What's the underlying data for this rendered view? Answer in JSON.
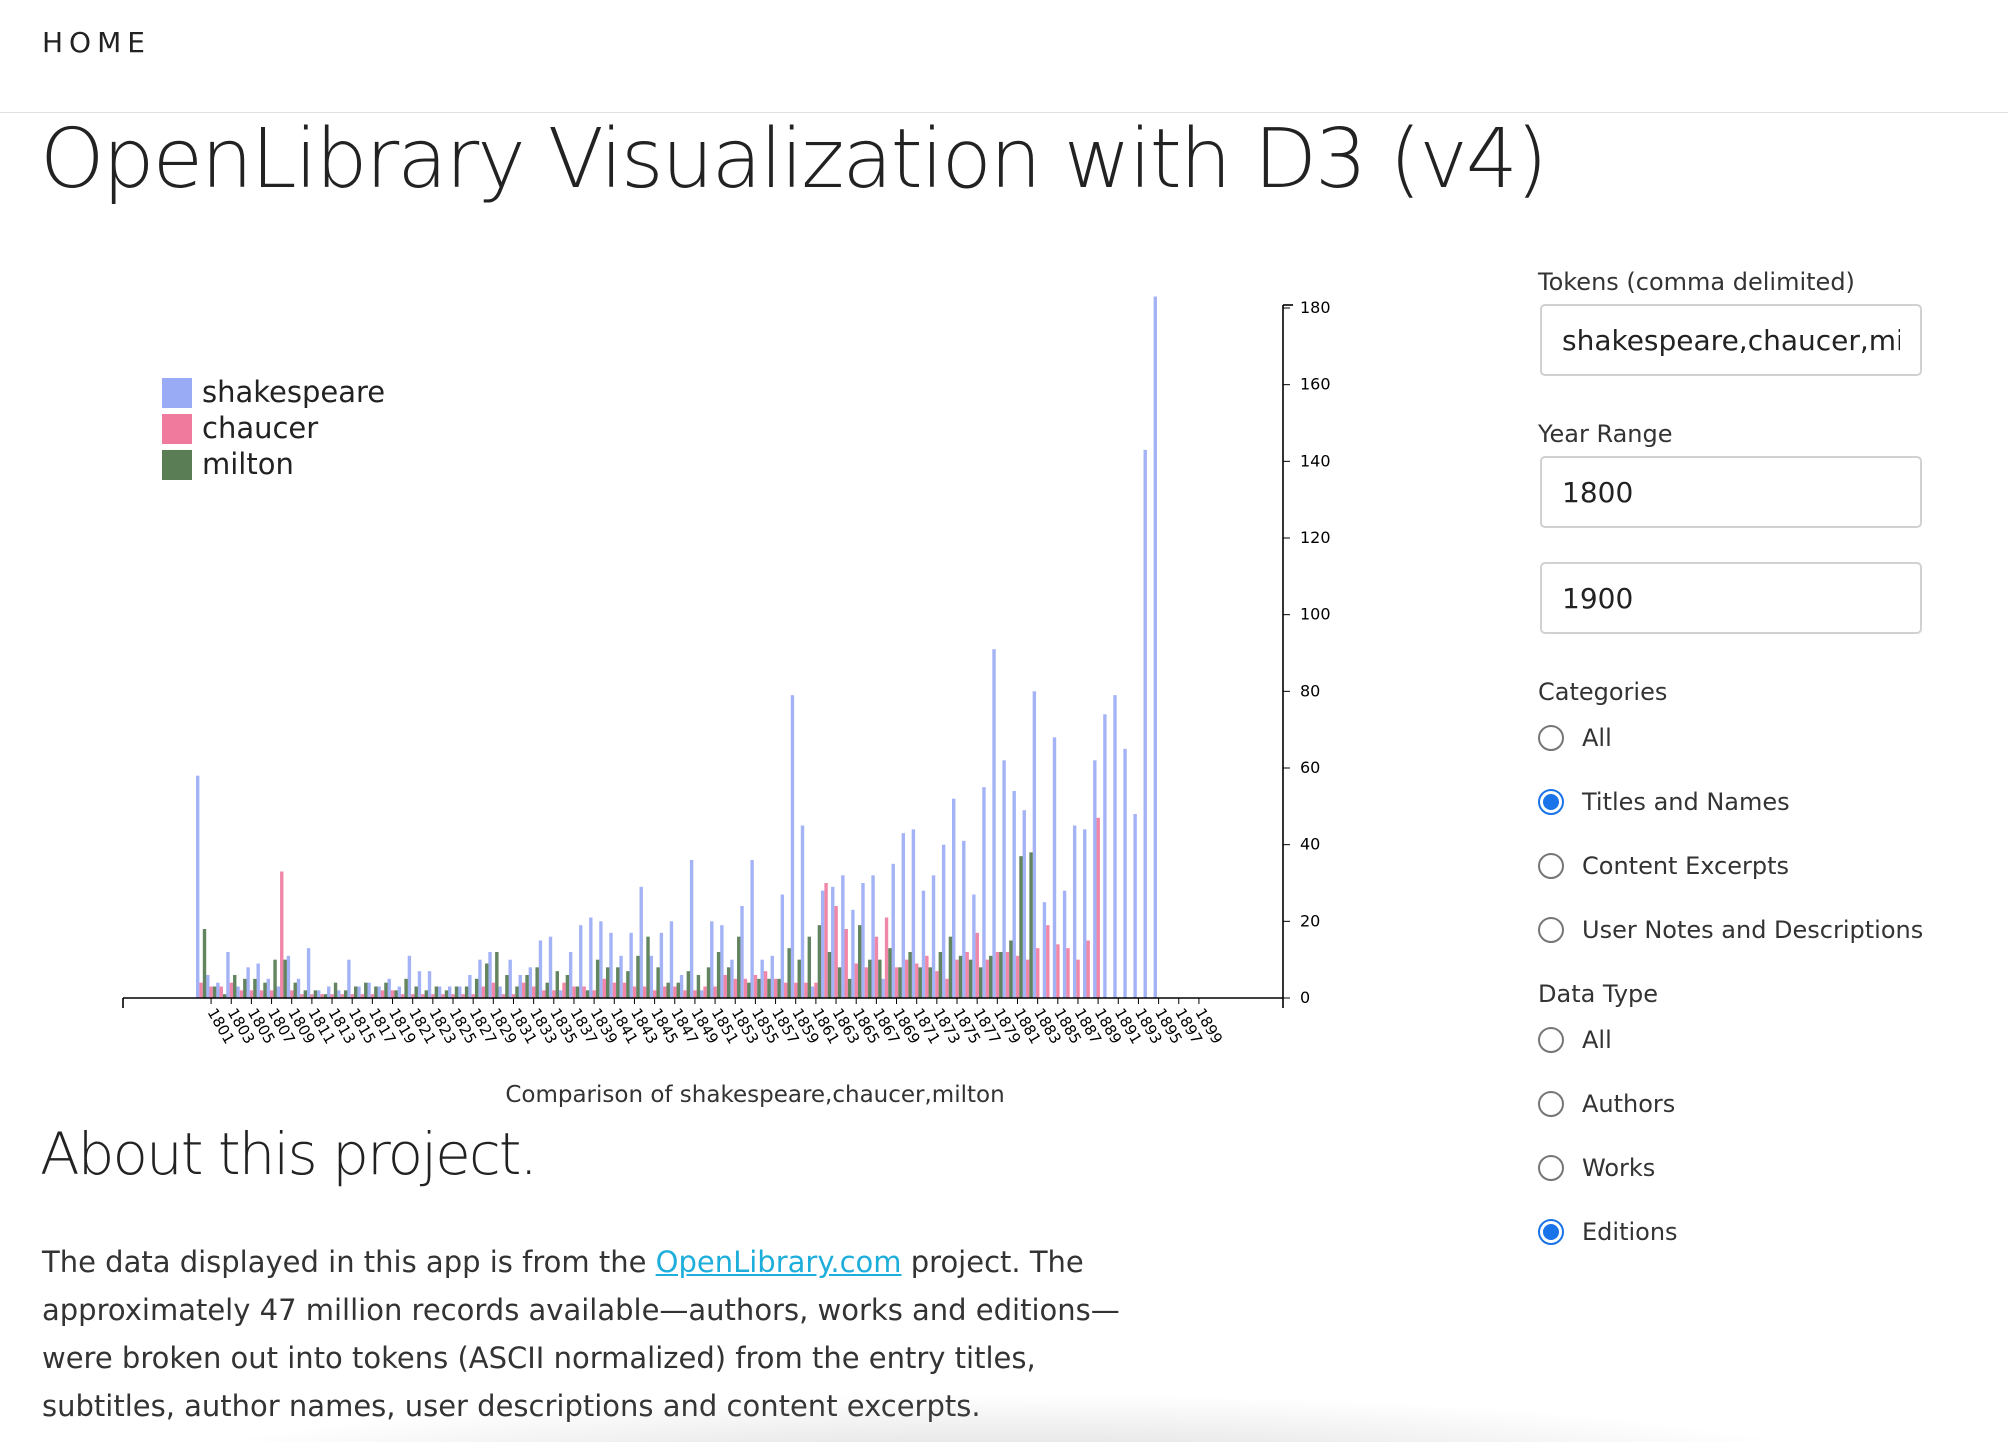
{
  "nav": {
    "home": "HOME"
  },
  "page": {
    "title": "OpenLibrary Visualization with D3 (v4)"
  },
  "sidebar": {
    "tokens_label": "Tokens (comma delimited)",
    "tokens_value": "shakespeare,chaucer,milton",
    "year_range_label": "Year Range",
    "year_start": "1800",
    "year_end": "1900",
    "categories_label": "Categories",
    "categories": [
      {
        "label": "All",
        "checked": false
      },
      {
        "label": "Titles and Names",
        "checked": true
      },
      {
        "label": "Content Excerpts",
        "checked": false
      },
      {
        "label": "User Notes and Descriptions",
        "checked": false
      }
    ],
    "data_type_label": "Data Type",
    "data_types": [
      {
        "label": "All",
        "checked": false
      },
      {
        "label": "Authors",
        "checked": false
      },
      {
        "label": "Works",
        "checked": false
      },
      {
        "label": "Editions",
        "checked": true
      }
    ]
  },
  "about": {
    "heading": "About this project.",
    "text_before": "The data displayed in this app is from the ",
    "link_text": "OpenLibrary.com",
    "text_after": " project. The approximately 47 million records available—authors, works and editions—were broken out into tokens (ASCII normalized) from the entry titles, subtitles, author names, user descriptions and content excerpts."
  },
  "chart_data": {
    "type": "bar",
    "caption": "Comparison of shakespeare,chaucer,milton",
    "ylim": [
      0,
      180
    ],
    "yticks": [
      0,
      20,
      40,
      60,
      80,
      100,
      120,
      140,
      160,
      180
    ],
    "legend_position": "top-left",
    "categories": [
      1800,
      1801,
      1802,
      1803,
      1804,
      1805,
      1806,
      1807,
      1808,
      1809,
      1810,
      1811,
      1812,
      1813,
      1814,
      1815,
      1816,
      1817,
      1818,
      1819,
      1820,
      1821,
      1822,
      1823,
      1824,
      1825,
      1826,
      1827,
      1828,
      1829,
      1830,
      1831,
      1832,
      1833,
      1834,
      1835,
      1836,
      1837,
      1838,
      1839,
      1840,
      1841,
      1842,
      1843,
      1844,
      1845,
      1846,
      1847,
      1848,
      1849,
      1850,
      1851,
      1852,
      1853,
      1854,
      1855,
      1856,
      1857,
      1858,
      1859,
      1860,
      1861,
      1862,
      1863,
      1864,
      1865,
      1866,
      1867,
      1868,
      1869,
      1870,
      1871,
      1872,
      1873,
      1874,
      1875,
      1876,
      1877,
      1878,
      1879,
      1880,
      1881,
      1882,
      1883,
      1884,
      1885,
      1886,
      1887,
      1888,
      1889,
      1890,
      1891,
      1892,
      1893,
      1894,
      1895,
      1896,
      1897,
      1898,
      1899
    ],
    "xtick_labels": [
      "1801",
      "1803",
      "1805",
      "1807",
      "1809",
      "1811",
      "1813",
      "1815",
      "1817",
      "1819",
      "1821",
      "1823",
      "1825",
      "1827",
      "1829",
      "1831",
      "1833",
      "1835",
      "1837",
      "1839",
      "1841",
      "1843",
      "1845",
      "1847",
      "1849",
      "1851",
      "1853",
      "1855",
      "1857",
      "1859",
      "1861",
      "1863",
      "1865",
      "1867",
      "1869",
      "1871",
      "1873",
      "1875",
      "1877",
      "1879",
      "1881",
      "1883",
      "1885",
      "1887",
      "1889",
      "1891",
      "1893",
      "1895",
      "1897",
      "1899"
    ],
    "series": [
      {
        "name": "shakespeare",
        "color": "#9aabf5",
        "values": [
          58,
          6,
          4,
          12,
          3,
          8,
          9,
          5,
          3,
          11,
          5,
          13,
          2,
          3,
          2,
          10,
          3,
          4,
          3,
          5,
          3,
          11,
          7,
          7,
          3,
          3,
          3,
          6,
          10,
          12,
          3,
          10,
          6,
          8,
          15,
          16,
          2,
          12,
          19,
          21,
          20,
          17,
          11,
          17,
          29,
          11,
          17,
          20,
          6,
          36,
          2,
          20,
          19,
          10,
          24,
          36,
          10,
          11,
          27,
          79,
          45,
          3,
          28,
          29,
          32,
          23,
          30,
          32,
          5,
          35,
          43,
          44,
          28,
          32,
          40,
          52,
          41,
          27,
          55,
          91,
          62,
          54,
          49,
          80,
          25,
          68,
          28,
          45,
          44,
          62,
          74,
          79,
          65,
          48,
          143,
          183,
          0,
          0,
          0,
          0
        ]
      },
      {
        "name": "chaucer",
        "color": "#f07a9e",
        "values": [
          4,
          3,
          3,
          4,
          2,
          2,
          2,
          2,
          33,
          2,
          1,
          1,
          1,
          1,
          1,
          1,
          1,
          1,
          2,
          2,
          1,
          1,
          1,
          1,
          1,
          1,
          1,
          1,
          3,
          4,
          1,
          1,
          4,
          3,
          2,
          2,
          4,
          3,
          3,
          2,
          5,
          4,
          4,
          3,
          3,
          2,
          3,
          3,
          2,
          2,
          3,
          3,
          6,
          5,
          5,
          6,
          7,
          5,
          4,
          4,
          4,
          4,
          30,
          24,
          18,
          9,
          8,
          16,
          21,
          8,
          10,
          9,
          11,
          7,
          5,
          10,
          12,
          17,
          10,
          12,
          12,
          11,
          10,
          13,
          19,
          14,
          13,
          10,
          15,
          47,
          0,
          0,
          0,
          0,
          0,
          0,
          0,
          0,
          0,
          0
        ]
      },
      {
        "name": "milton",
        "color": "#5a7d56",
        "values": [
          18,
          3,
          1,
          6,
          5,
          5,
          4,
          10,
          10,
          4,
          2,
          2,
          1,
          4,
          2,
          3,
          4,
          3,
          4,
          2,
          5,
          3,
          2,
          3,
          2,
          3,
          3,
          5,
          9,
          12,
          6,
          3,
          6,
          8,
          4,
          7,
          6,
          3,
          2,
          10,
          8,
          8,
          7,
          11,
          16,
          8,
          4,
          4,
          7,
          6,
          8,
          12,
          8,
          16,
          4,
          5,
          5,
          5,
          13,
          10,
          16,
          19,
          12,
          8,
          5,
          19,
          10,
          10,
          13,
          8,
          12,
          8,
          8,
          12,
          16,
          11,
          10,
          8,
          11,
          12,
          15,
          37,
          38,
          0,
          0,
          0,
          0,
          0,
          0,
          0,
          0,
          0,
          0,
          0,
          0,
          0,
          0,
          0,
          0,
          0
        ]
      }
    ]
  }
}
